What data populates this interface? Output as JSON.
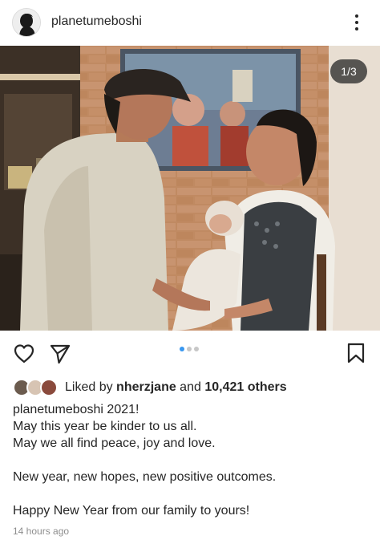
{
  "post": {
    "username": "planetumeboshi",
    "image_counter": "1/3",
    "slide_count": 3,
    "active_slide": 1
  },
  "likes": {
    "prefix": "Liked by ",
    "user": "nherzjane",
    "and": " and ",
    "others": "10,421 others"
  },
  "caption": {
    "username": "planetumeboshi",
    "first_line": " 2021!",
    "lines": [
      "May this year be kinder to us all.",
      "May we all find peace, joy and love.",
      "",
      "New year, new hopes, new positive outcomes.",
      "",
      "Happy New Year from our family to yours!"
    ]
  },
  "timestamp": "14 hours ago",
  "icons": {
    "more": "more-options-icon",
    "like": "heart-icon",
    "share": "paper-plane-icon",
    "save": "bookmark-icon"
  },
  "colors": {
    "accent": "#3897f0",
    "text": "#262626",
    "muted": "#8e8e8e"
  }
}
